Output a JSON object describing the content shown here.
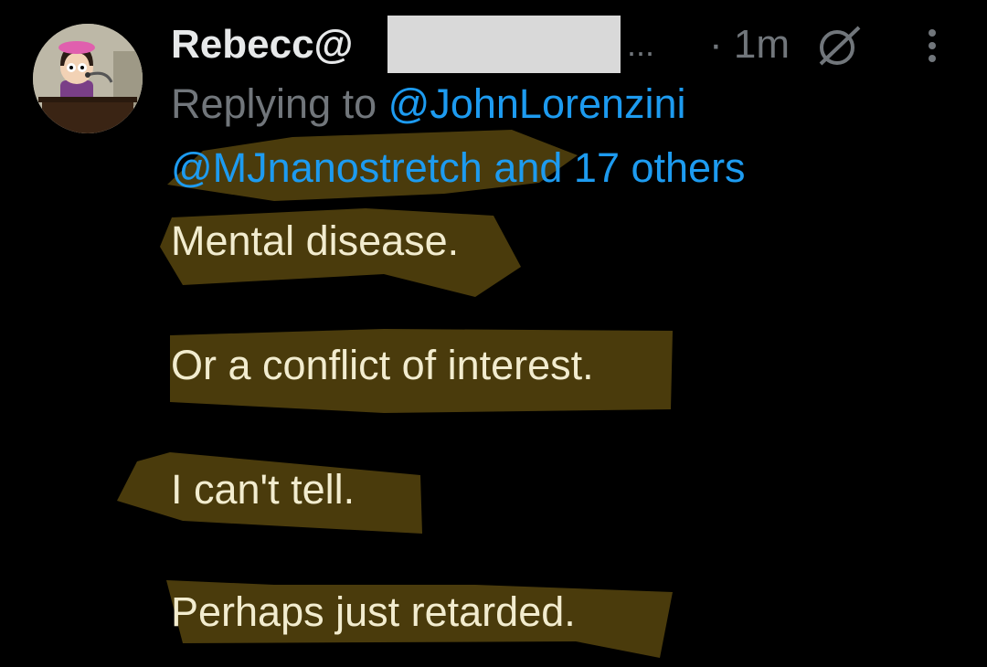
{
  "tweet": {
    "author": {
      "display_name": "Rebecc@",
      "avatar_icon": "cartoon-avatar-icon"
    },
    "truncation": "...",
    "timestamp": "· 1m",
    "status_icon": "no-sign-icon",
    "more_icon": "more-vertical-icon",
    "reply": {
      "prefix": "Replying to",
      "mention_1": "@JohnLorenzini",
      "mention_2": "@MJnanostretch",
      "and_others": "and 17 others"
    },
    "body_lines": [
      "Mental disease.",
      "Or a conflict of interest.",
      "I can't tell.",
      "Perhaps just retarded."
    ]
  },
  "colors": {
    "background": "#000000",
    "text_primary": "#e7e9ea",
    "text_secondary": "#71767b",
    "link": "#1d9bf0",
    "highlighter": "#4a3b0c",
    "highlighted_text": "#f2eccf",
    "redaction": "#d9d9d9"
  }
}
